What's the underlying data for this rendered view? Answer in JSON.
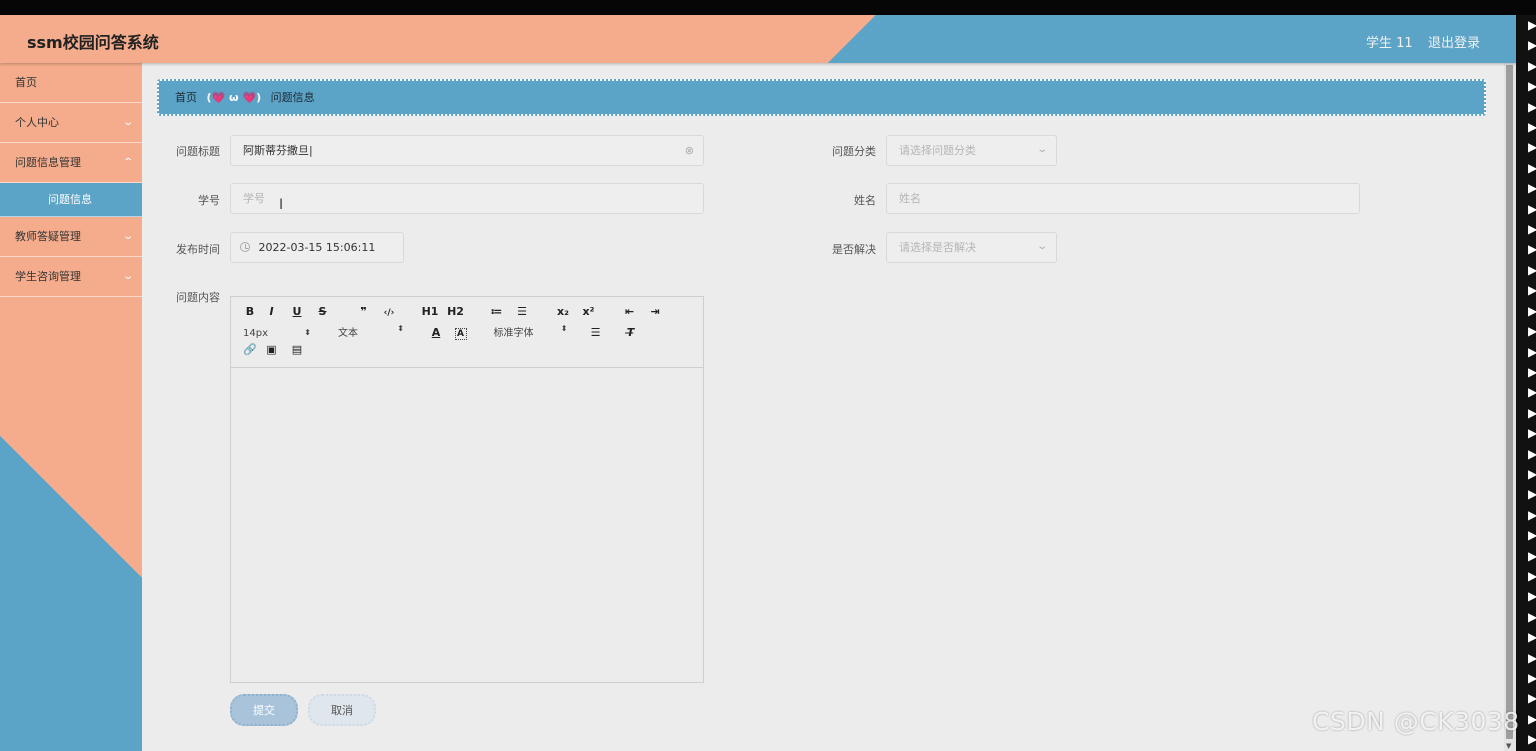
{
  "header": {
    "app_title": "ssm校园问答系统",
    "user": "学生 11",
    "logout": "退出登录"
  },
  "sidebar": {
    "items": [
      {
        "label": "首页"
      },
      {
        "label": "个人中心"
      },
      {
        "label": "问题信息管理"
      },
      {
        "label": "问题信息"
      },
      {
        "label": "教师答疑管理"
      },
      {
        "label": "学生咨询管理"
      }
    ]
  },
  "breadcrumb": {
    "home": "首页",
    "separator": "(💗 ω 💗)",
    "current": "问题信息"
  },
  "form": {
    "title": {
      "label": "问题标题",
      "value": "阿斯蒂芬撒旦|"
    },
    "category": {
      "label": "问题分类",
      "placeholder": "请选择问题分类"
    },
    "student_id": {
      "label": "学号",
      "placeholder": "学号"
    },
    "name": {
      "label": "姓名",
      "placeholder": "姓名"
    },
    "publish_time": {
      "label": "发布时间",
      "value": "2022-03-15 15:06:11"
    },
    "resolved": {
      "label": "是否解决",
      "placeholder": "请选择是否解决"
    },
    "content": {
      "label": "问题内容"
    }
  },
  "editor": {
    "toolbar_row1": [
      "B",
      "I",
      "U",
      "S",
      "❞",
      "‹/›",
      "H1",
      "H2",
      "≔",
      "☰",
      "x₂",
      "x²",
      "⇤",
      "⇥"
    ],
    "font_size": "14px",
    "text_type": "文本",
    "font_family": "标准字体"
  },
  "buttons": {
    "submit": "提交",
    "cancel": "取消"
  },
  "watermark": "CSDN @CK3038"
}
